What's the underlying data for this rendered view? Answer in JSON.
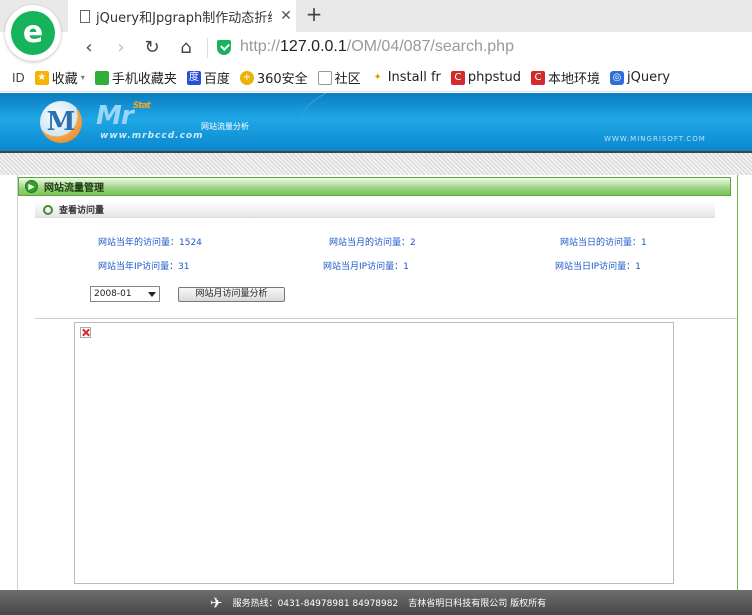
{
  "browser": {
    "tab_title": "jQuery和Jpgraph制作动态折线图",
    "close_glyph": "✕",
    "new_tab_glyph": "+",
    "url_scheme": "http://",
    "url_host": "127.0.0.1",
    "url_path": "/OM/04/087/search.php",
    "nav": {
      "back": "‹",
      "forward": "›",
      "reload": "↻",
      "home": "⌂"
    },
    "sidebar_toggle": "ID"
  },
  "bookmarks": [
    {
      "label": "收藏",
      "icon": "star-icon",
      "color": "#f5b400"
    },
    {
      "label": "手机收藏夹",
      "icon": "phone-icon",
      "color": "#2fae3a"
    },
    {
      "label": "百度",
      "icon": "baidu-icon",
      "color": "#2a4fd6"
    },
    {
      "label": "360安全",
      "icon": "360-icon",
      "color": "#e8b400"
    },
    {
      "label": "社区",
      "icon": "page-icon",
      "color": "#999999"
    },
    {
      "label": "Install fr",
      "icon": "wand-icon",
      "color": "#e0a000"
    },
    {
      "label": "phpstud",
      "icon": "phpstudy-icon",
      "color": "#d22b2b"
    },
    {
      "label": "本地环境",
      "icon": "phpstudy-icon",
      "color": "#d22b2b"
    },
    {
      "label": "jQuery",
      "icon": "jquery-icon",
      "color": "#2f6ed8"
    }
  ],
  "banner": {
    "logo_letter": "M",
    "brand_part1": "Mr",
    "brand_part2": "Stat",
    "tagline": "网站流量分析",
    "site_left": "www.mrbccd.com",
    "site_right": "WWW.MINGRISOFT.COM"
  },
  "section": {
    "title": "网站流量管理",
    "subtitle": "查看访问量"
  },
  "stats": {
    "year_pv": "网站当年的访问量：1524",
    "month_pv": "网站当月的访问量：2",
    "day_pv": "网站当日的访问量：1",
    "year_ip": "网站当年IP访问量：31",
    "month_ip": "网站当月IP访问量：1",
    "day_ip": "网站当日IP访问量：1"
  },
  "controls": {
    "month_select": "2008-01",
    "analyze_button": "网站月访问量分析"
  },
  "footer": {
    "hotline": "服务热线：0431-84978981  84978982",
    "company": "吉林省明日科技有限公司  版权所有"
  }
}
